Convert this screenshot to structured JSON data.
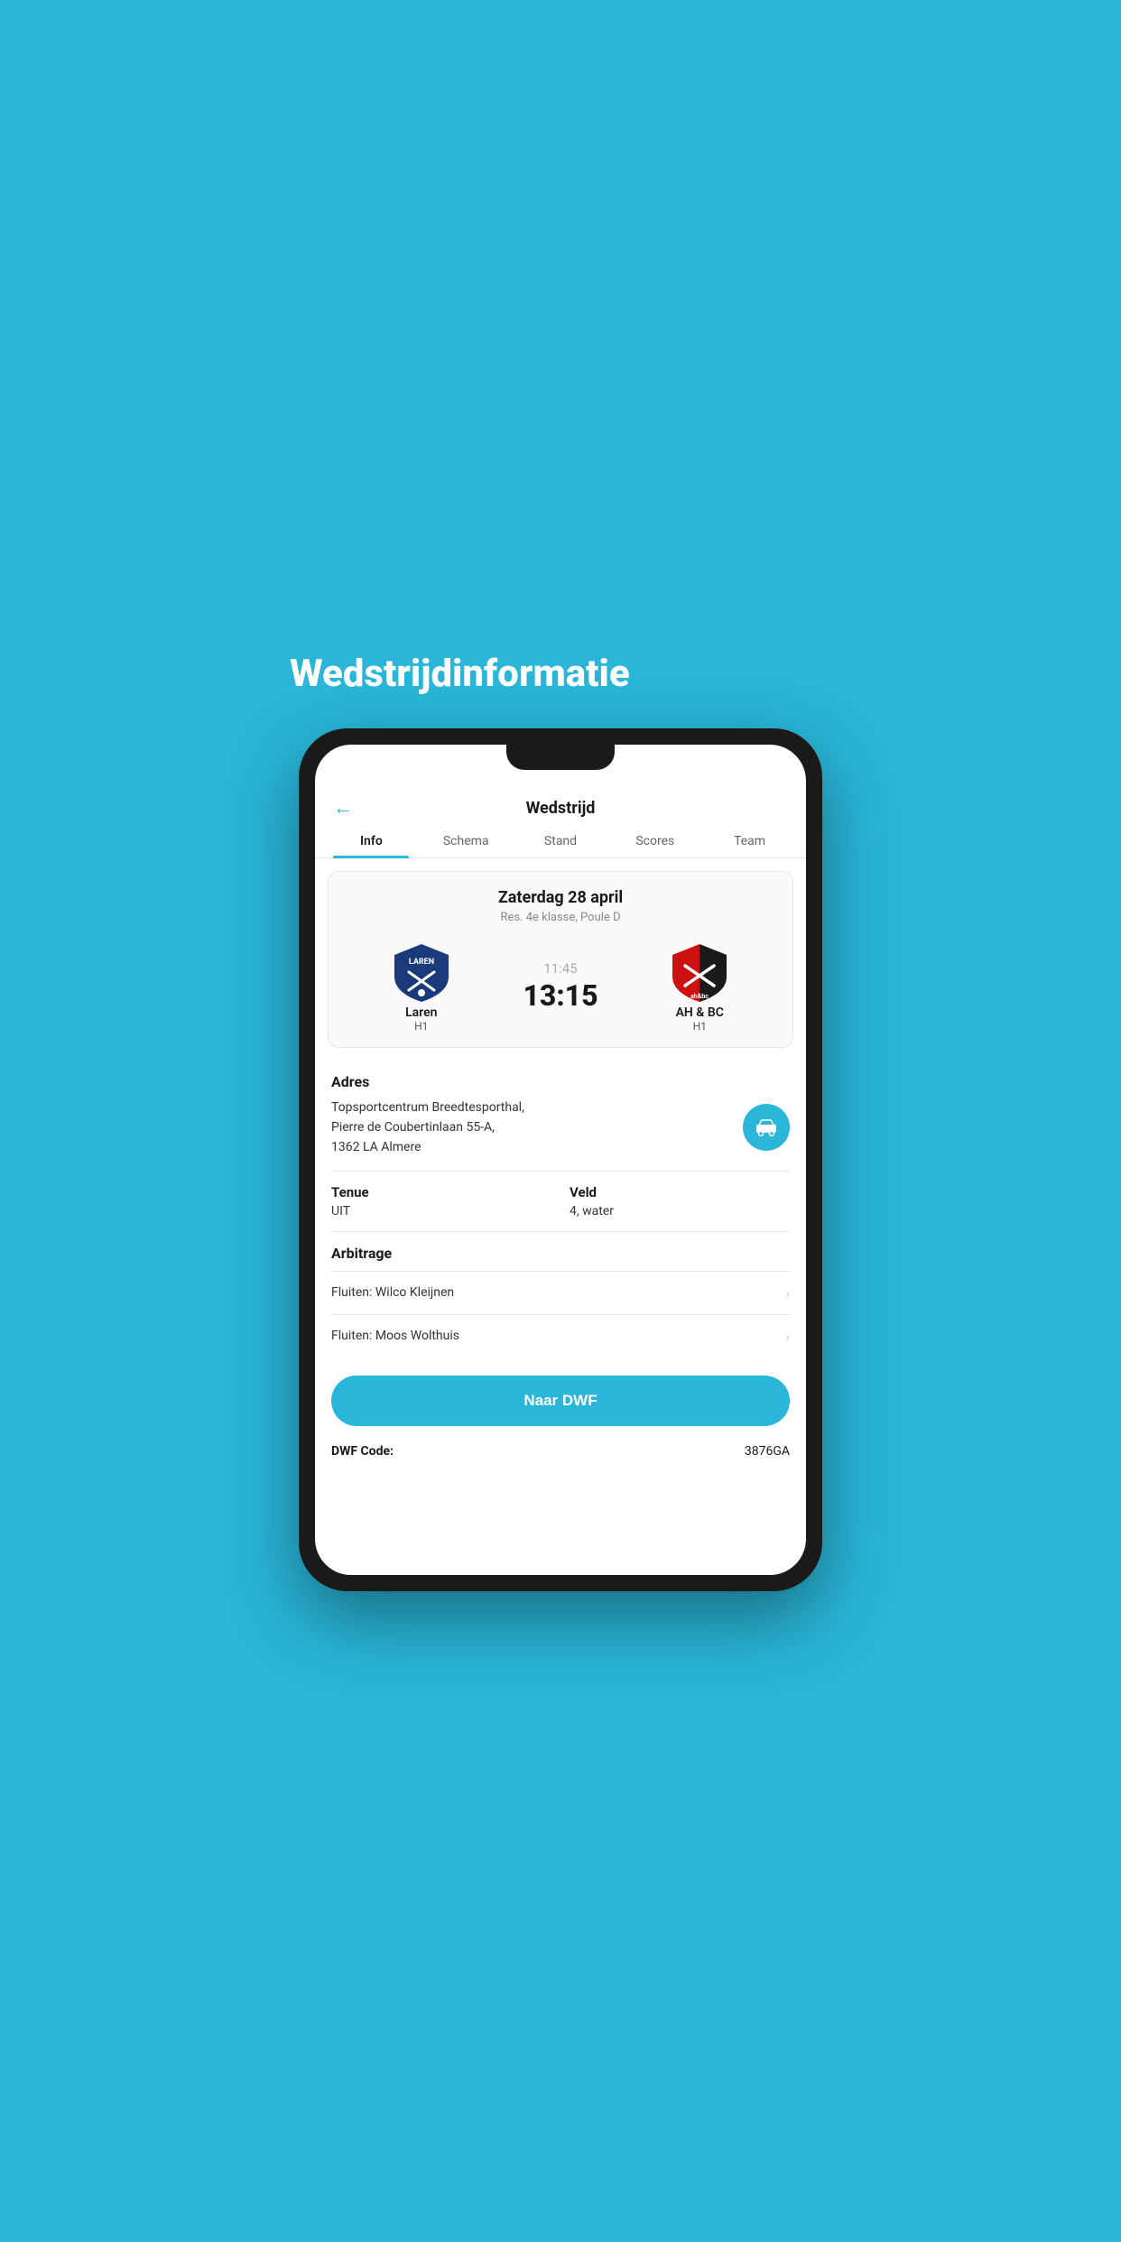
{
  "page": {
    "bg_title": "Wedstrijdinformatie",
    "header": {
      "back_label": "←",
      "title": "Wedstrijd"
    },
    "tabs": [
      {
        "id": "info",
        "label": "Info",
        "active": true
      },
      {
        "id": "schema",
        "label": "Schema",
        "active": false
      },
      {
        "id": "stand",
        "label": "Stand",
        "active": false
      },
      {
        "id": "scores",
        "label": "Scores",
        "active": false
      },
      {
        "id": "team",
        "label": "Team",
        "active": false
      }
    ],
    "match": {
      "date": "Zaterdag 28 april",
      "league": "Res. 4e klasse, Poule D",
      "home_team": "Laren",
      "home_sub": "H1",
      "away_team": "AH & BC",
      "away_sub": "H1",
      "time": "11:45",
      "score": "13:15"
    },
    "address": {
      "label": "Adres",
      "text_line1": "Topsportcentrum Breedtesporthal,",
      "text_line2": "Pierre de Coubertinlaan 55-A,",
      "text_line3": "1362 LA Almere"
    },
    "tenue": {
      "label": "Tenue",
      "value": "UIT"
    },
    "veld": {
      "label": "Veld",
      "value": "4, water"
    },
    "arbitrage": {
      "label": "Arbitrage",
      "items": [
        {
          "text": "Fluiten: Wilco Kleijnen"
        },
        {
          "text": "Fluiten: Moos Wolthuis"
        }
      ]
    },
    "dwf_button_label": "Naar DWF",
    "dwf_code_label": "DWF Code:",
    "dwf_code_value": "3876GA",
    "colors": {
      "accent": "#29B6D8"
    }
  }
}
